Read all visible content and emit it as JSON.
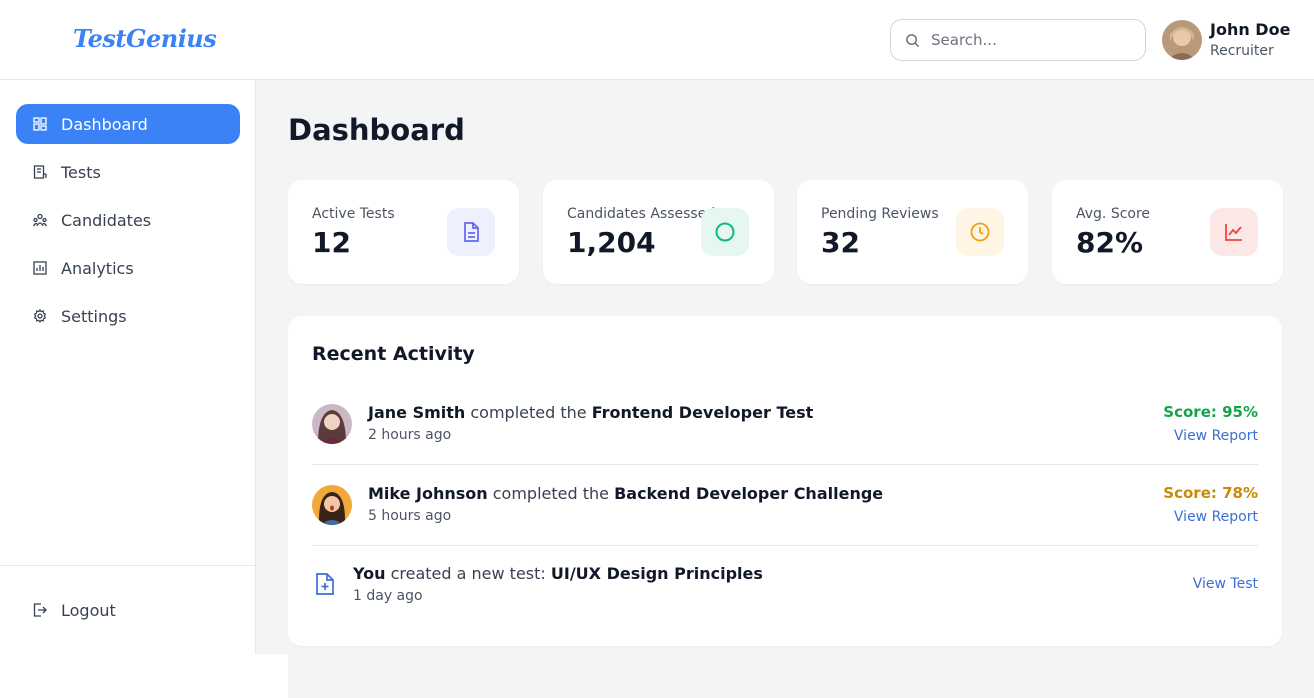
{
  "app": {
    "logo": "TestGenius"
  },
  "header": {
    "search_placeholder": "Search...",
    "user": {
      "name": "John Doe",
      "role": "Recruiter"
    }
  },
  "sidebar": {
    "items": [
      {
        "label": "Dashboard",
        "icon": "dashboard-icon",
        "active": true
      },
      {
        "label": "Tests",
        "icon": "tests-icon"
      },
      {
        "label": "Candidates",
        "icon": "candidates-icon"
      },
      {
        "label": "Analytics",
        "icon": "analytics-icon"
      },
      {
        "label": "Settings",
        "icon": "gear-icon"
      }
    ],
    "logout": {
      "label": "Logout",
      "icon": "logout-icon"
    }
  },
  "main": {
    "title": "Dashboard",
    "stats": [
      {
        "label": "Active Tests",
        "value": "12",
        "icon": "document-icon",
        "color": "#6366f1",
        "bg": "#eef0fd"
      },
      {
        "label": "Candidates Assessed",
        "value": "1,204",
        "icon": "circle-icon",
        "color": "#10b981",
        "bg": "#e6f7f1"
      },
      {
        "label": "Pending Reviews",
        "value": "32",
        "icon": "clock-icon",
        "color": "#f59e0b",
        "bg": "#fef5e5"
      },
      {
        "label": "Avg. Score",
        "value": "82%",
        "icon": "chart-line-icon",
        "color": "#ef4444",
        "bg": "#fde8e8"
      }
    ],
    "activity": {
      "title": "Recent Activity",
      "items": [
        {
          "actor": "Jane Smith",
          "verb": " completed the ",
          "object": "Frontend Developer Test",
          "time": "2 hours ago",
          "score": "Score: 95%",
          "score_color": "#16a34a",
          "link": "View Report"
        },
        {
          "actor": "Mike Johnson",
          "verb": " completed the ",
          "object": "Backend Developer Challenge",
          "time": "5 hours ago",
          "score": "Score: 78%",
          "score_color": "#ca8a04",
          "link": "View Report"
        },
        {
          "actor": "You",
          "verb": " created a new test: ",
          "object": "UI/UX Design Principles",
          "time": "1 day ago",
          "link": "View Test",
          "icon": "document-plus-icon"
        }
      ]
    }
  }
}
